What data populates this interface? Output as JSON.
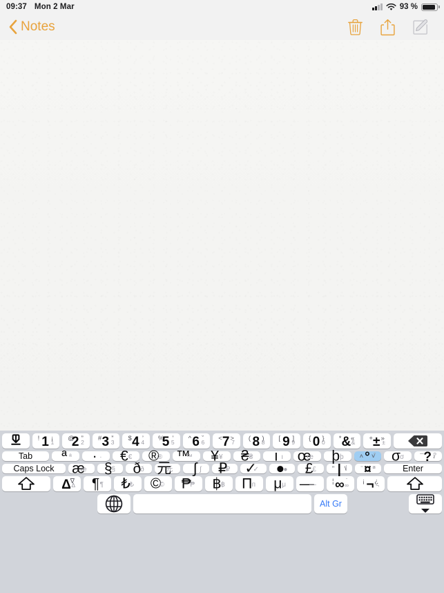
{
  "status_bar": {
    "time": "09:37",
    "date": "Mon 2 Mar",
    "battery_percent": "93 %",
    "signal_icon": "cellular-signal-icon",
    "wifi_icon": "wifi-icon",
    "battery_icon": "battery-icon"
  },
  "nav": {
    "back_label": "Notes",
    "back_icon": "chevron-left-icon",
    "delete_icon": "trash-icon",
    "share_icon": "share-icon",
    "compose_icon": "compose-icon",
    "accent_color": "#e8a33d",
    "disabled_color": "#c7c7cc"
  },
  "note": {
    "body_text": "",
    "placeholder": ""
  },
  "keyboard": {
    "background_color": "#d1d4da",
    "key_color": "#ffffff",
    "highlight_color": "#9fcdf2",
    "blue_label_color": "#3478f6",
    "rows": [
      {
        "name": "row-number",
        "keys": [
          {
            "name": "key-shift-down",
            "type": "icon",
            "icon": "arrow-down-into-line-icon"
          },
          {
            "name": "key-1",
            "type": "quad",
            "tl": "!",
            "tr": "¡",
            "main": "1",
            "br": "1"
          },
          {
            "name": "key-2",
            "type": "quad",
            "tl": "@",
            "tr": "”",
            "main": "2",
            "br": "2"
          },
          {
            "name": "key-3",
            "type": "quad",
            "tl": "#",
            "tr": "”",
            "main": "3",
            "br": "3"
          },
          {
            "name": "key-4",
            "type": "quad",
            "tl": "$",
            "tr": "’",
            "main": "4",
            "br": "4"
          },
          {
            "name": "key-5",
            "type": "quad",
            "tl": "%",
            "tr": "’",
            "main": "5",
            "br": "5"
          },
          {
            "name": "key-6",
            "type": "quad",
            "tl": "^",
            "tr": "ˇ",
            "main": "6",
            "br": "6"
          },
          {
            "name": "key-7",
            "type": "quad",
            "tl": "<",
            "tr": ">",
            "main": "7",
            "br": "7"
          },
          {
            "name": "key-8",
            "type": "quad",
            "tl": "(",
            "tr": ")",
            "main": "8",
            "br": "8"
          },
          {
            "name": "key-9",
            "type": "quad",
            "tl": "[",
            "tr": "]",
            "main": "9",
            "br": "9"
          },
          {
            "name": "key-0",
            "type": "quad",
            "tl": "{",
            "tr": "}",
            "main": "0",
            "br": "0"
          },
          {
            "name": "key-ampersand",
            "type": "quad",
            "tl": "*",
            "tr": "«",
            "main": "&",
            "br": "&"
          },
          {
            "name": "key-plusminus",
            "type": "quad",
            "tl": "+",
            "tr": "»",
            "main": "±",
            "br": "±"
          },
          {
            "name": "key-delete",
            "type": "icon",
            "icon": "delete-backward-icon"
          }
        ]
      },
      {
        "name": "row-upper",
        "keys": [
          {
            "name": "key-tab",
            "type": "text",
            "label": "Tab"
          },
          {
            "name": "key-a-superscript",
            "type": "sym",
            "main": "ª",
            "sub": "ª"
          },
          {
            "name": "key-middle-dot",
            "type": "sym",
            "main": "·",
            "sub": "·"
          },
          {
            "name": "key-euro",
            "type": "sym",
            "main": "€",
            "sub": "€"
          },
          {
            "name": "key-registered",
            "type": "sym",
            "main": "®",
            "sub": "®"
          },
          {
            "name": "key-trademark",
            "type": "sym",
            "main": "™",
            "sub": "™"
          },
          {
            "name": "key-yen",
            "type": "sym",
            "main": "¥",
            "sub": "¥"
          },
          {
            "name": "key-euro-currency-old",
            "type": "sym",
            "main": "₴",
            "sub": "₴"
          },
          {
            "name": "key-bar",
            "type": "sym",
            "main": "ı",
            "sub": "ı"
          },
          {
            "name": "key-oe-ligature",
            "type": "sym",
            "main": "œ",
            "sub": "œ"
          },
          {
            "name": "key-thorn",
            "type": "sym",
            "main": "þ",
            "sub": "þ"
          },
          {
            "name": "key-degree",
            "type": "quad",
            "tl": "˄",
            "tr": "˅",
            "main": "°",
            "br": "°",
            "active": true
          },
          {
            "name": "key-sigma",
            "type": "sym",
            "main": "σ",
            "sub": "σ"
          },
          {
            "name": "key-question",
            "type": "quad",
            "tl": "¯",
            "tr": "↓",
            "main": "?",
            "br": "?"
          }
        ]
      },
      {
        "name": "row-home",
        "keys": [
          {
            "name": "key-caps-lock",
            "type": "text",
            "label": "Caps Lock"
          },
          {
            "name": "key-ae-ligature",
            "type": "sym",
            "main": "æ",
            "sub": "æ"
          },
          {
            "name": "key-section",
            "type": "sym",
            "main": "§",
            "sub": "§"
          },
          {
            "name": "key-eth",
            "type": "sym",
            "main": "ð",
            "sub": "ð"
          },
          {
            "name": "key-yuan",
            "type": "sym",
            "main": "元",
            "sub": "元"
          },
          {
            "name": "key-integral",
            "type": "sym",
            "main": "∫",
            "sub": "∫"
          },
          {
            "name": "key-ruble",
            "type": "sym",
            "main": "₽",
            "sub": "₽"
          },
          {
            "name": "key-check",
            "type": "sym",
            "main": "✓",
            "sub": "✓"
          },
          {
            "name": "key-bullet",
            "type": "sym",
            "main": "●",
            "sub": "●"
          },
          {
            "name": "key-pound",
            "type": "sym",
            "main": "£",
            "sub": "£"
          },
          {
            "name": "key-pipe",
            "type": "quad",
            "tl": "\"",
            "tr": "\\",
            "main": "|",
            "br": "|"
          },
          {
            "name": "key-currency",
            "type": "quad",
            "tl": "¨",
            "tr": "’",
            "main": "¤",
            "br": "¤"
          },
          {
            "name": "key-enter",
            "type": "text",
            "label": "Enter"
          }
        ]
      },
      {
        "name": "row-bottom-letters",
        "keys": [
          {
            "name": "key-shift-left",
            "type": "icon",
            "icon": "shift-icon"
          },
          {
            "name": "key-delta",
            "type": "quad",
            "tl": "",
            "tr": "∇",
            "main": "Δ",
            "br": "Δ"
          },
          {
            "name": "key-pilcrow",
            "type": "sym",
            "main": "¶",
            "sub": "¶"
          },
          {
            "name": "key-lira",
            "type": "sym",
            "main": "₺",
            "sub": "₺"
          },
          {
            "name": "key-copyright",
            "type": "sym",
            "main": "©",
            "sub": "©"
          },
          {
            "name": "key-peso",
            "type": "sym",
            "main": "₱",
            "sub": "₱"
          },
          {
            "name": "key-baht",
            "type": "sym",
            "main": "฿",
            "sub": "฿"
          },
          {
            "name": "key-capital-pi",
            "type": "sym",
            "main": "Π",
            "sub": "п"
          },
          {
            "name": "key-mu",
            "type": "sym",
            "main": "μ",
            "sub": "μ"
          },
          {
            "name": "key-em-dash",
            "type": "sym",
            "main": "—",
            "sub": "—"
          },
          {
            "name": "key-infinity",
            "type": "quad",
            "tl": "¦",
            "tr": "˙",
            "main": "∞",
            "br": "∞"
          },
          {
            "name": "key-not-sign",
            "type": "quad",
            "tl": "¡",
            "tr": "¿",
            "main": "¬",
            "br": "¬"
          },
          {
            "name": "key-shift-right",
            "type": "icon",
            "icon": "shift-icon"
          }
        ]
      },
      {
        "name": "row-space",
        "keys": [
          {
            "name": "key-globe",
            "type": "icon",
            "icon": "globe-icon"
          },
          {
            "name": "key-space",
            "type": "text",
            "label": ""
          },
          {
            "name": "key-alt-gr",
            "type": "text",
            "label": "Alt Gr"
          },
          {
            "name": "key-dismiss-keyboard",
            "type": "icon",
            "icon": "keyboard-dismiss-icon"
          }
        ]
      }
    ]
  }
}
